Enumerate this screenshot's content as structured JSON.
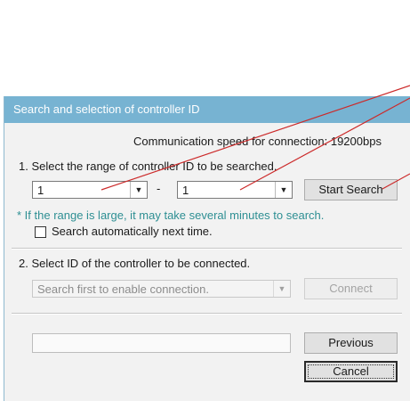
{
  "dialog": {
    "title": "Search and selection of controller ID",
    "comm_speed": "Communication speed for connection: 19200bps",
    "step1_label": "1. Select the range of controller ID to be searched.",
    "range_from": "1",
    "range_dash": "-",
    "range_to": "1",
    "start_search_label": "Start Search",
    "hint": "* If the range is large, it may take several minutes to search.",
    "auto_search_label": "Search automatically next time.",
    "step2_label": "2. Select ID of the controller to be connected.",
    "controller_select_value": "Search first to enable connection.",
    "connect_label": "Connect",
    "previous_label": "Previous",
    "cancel_label": "Cancel"
  },
  "colors": {
    "titlebar": "#77b3d2",
    "hint_text": "#2e8f93",
    "callout_line": "#cc2a2a"
  },
  "icons": {
    "dropdown_arrow": "chevron-down-icon",
    "checkbox": "checkbox-icon"
  }
}
